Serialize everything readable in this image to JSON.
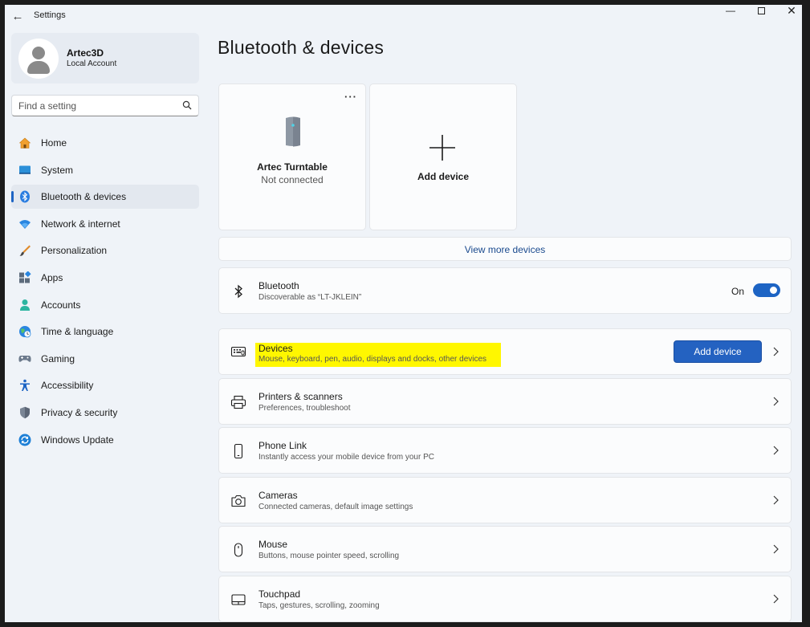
{
  "titlebar": {
    "app_title": "Settings",
    "back_glyph": "←",
    "minimize_glyph": "—",
    "close_glyph": "✕"
  },
  "profile": {
    "name": "Artec3D",
    "account_type": "Local Account"
  },
  "search": {
    "placeholder": "Find a setting"
  },
  "nav": {
    "active_index": 2,
    "items": [
      {
        "label": "Home",
        "icon": "home-icon"
      },
      {
        "label": "System",
        "icon": "system-icon"
      },
      {
        "label": "Bluetooth & devices",
        "icon": "bluetooth-icon"
      },
      {
        "label": "Network & internet",
        "icon": "wifi-icon"
      },
      {
        "label": "Personalization",
        "icon": "brush-icon"
      },
      {
        "label": "Apps",
        "icon": "apps-icon"
      },
      {
        "label": "Accounts",
        "icon": "accounts-icon"
      },
      {
        "label": "Time & language",
        "icon": "globe-clock-icon"
      },
      {
        "label": "Gaming",
        "icon": "gamepad-icon"
      },
      {
        "label": "Accessibility",
        "icon": "accessibility-icon"
      },
      {
        "label": "Privacy & security",
        "icon": "shield-icon"
      },
      {
        "label": "Windows Update",
        "icon": "update-icon"
      }
    ]
  },
  "page": {
    "title": "Bluetooth & devices"
  },
  "device_cards": {
    "device": {
      "name": "Artec Turntable",
      "status": "Not connected",
      "more_glyph": "···"
    },
    "add": {
      "label": "Add device"
    }
  },
  "view_more": {
    "label": "View more devices"
  },
  "bluetooth": {
    "title": "Bluetooth",
    "subtitle": "Discoverable as “LT-JKLEIN”",
    "toggle_label": "On",
    "toggle_on": true
  },
  "rows": {
    "devices": {
      "title": "Devices",
      "subtitle": "Mouse, keyboard, pen, audio, displays and docks, other devices",
      "button_label": "Add device"
    },
    "printers": {
      "title": "Printers & scanners",
      "subtitle": "Preferences, troubleshoot"
    },
    "phone": {
      "title": "Phone Link",
      "subtitle": "Instantly access your mobile device from your PC"
    },
    "cameras": {
      "title": "Cameras",
      "subtitle": "Connected cameras, default image settings"
    },
    "mouse": {
      "title": "Mouse",
      "subtitle": "Buttons, mouse pointer speed, scrolling"
    },
    "touchpad": {
      "title": "Touchpad",
      "subtitle": "Taps, gestures, scrolling, zooming"
    }
  },
  "colors": {
    "accent": "#1d64c4",
    "highlight": "#fff700",
    "window_bg": "#eff3f8"
  }
}
